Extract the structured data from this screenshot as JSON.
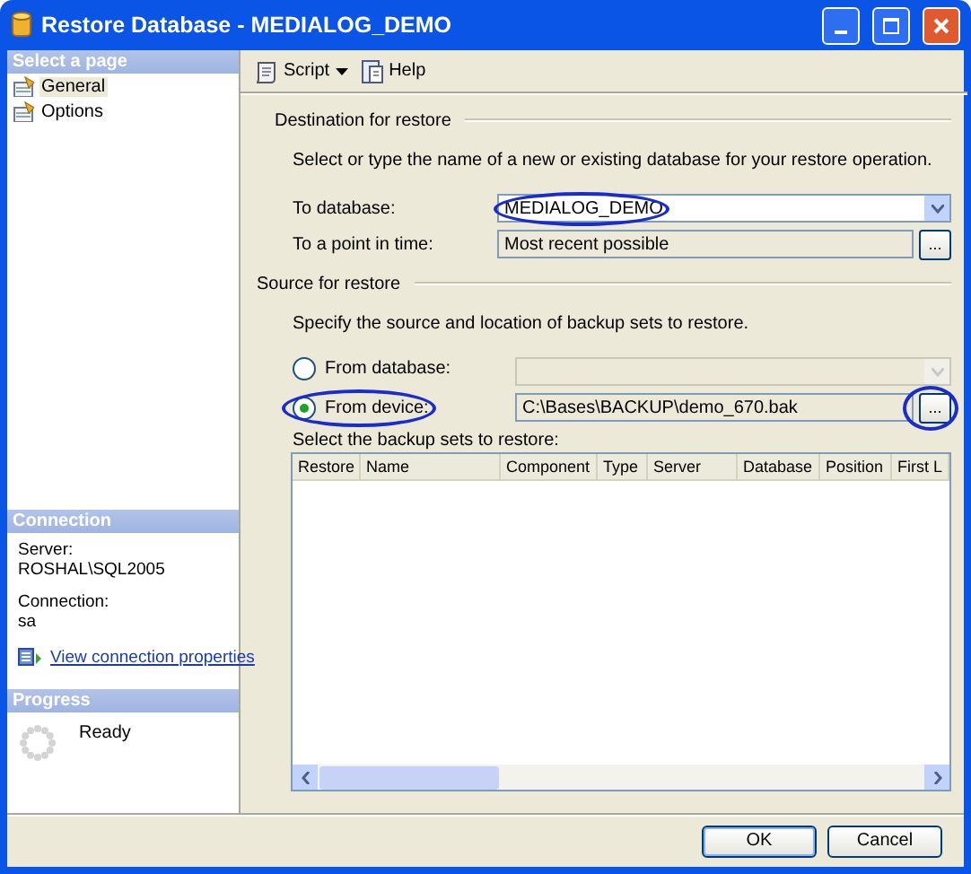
{
  "window": {
    "title": "Restore Database - MEDIALOG_DEMO"
  },
  "sidebar": {
    "header": "Select a page",
    "pages": [
      {
        "label": "General",
        "selected": true
      },
      {
        "label": "Options",
        "selected": false
      }
    ]
  },
  "connection": {
    "header": "Connection",
    "server_label": "Server:",
    "server": "ROSHAL\\SQL2005",
    "connection_label": "Connection:",
    "user": "sa",
    "link": "View connection properties"
  },
  "progress": {
    "header": "Progress",
    "status": "Ready"
  },
  "toolbar": {
    "script": "Script",
    "help": "Help"
  },
  "destination": {
    "title": "Destination for restore",
    "instruction": "Select or type the name of a new or existing database for your restore operation.",
    "to_database": {
      "label": "To database:",
      "value": "MEDIALOG_DEMO",
      "circled": true
    },
    "point_in_time": {
      "label": "To a point in time:",
      "value": "Most recent possible",
      "browse": "..."
    }
  },
  "source": {
    "title": "Source for restore",
    "instruction": "Specify the source and location of backup sets to restore.",
    "options": [
      {
        "label": "From database:",
        "selected": false,
        "enabled": false,
        "circled": false
      },
      {
        "label": "From device:",
        "selected": true,
        "value": "C:\\Bases\\BACKUP\\demo_670.bak",
        "enabled": true,
        "circled": true
      }
    ],
    "browse": {
      "label": "...",
      "circled": true
    },
    "table_label": "Select the backup sets to restore:",
    "table": {
      "columns": [
        "Restore",
        "Name",
        "Component",
        "Type",
        "Server",
        "Database",
        "Position",
        "First L"
      ]
    }
  },
  "buttons": [
    "OK",
    "Cancel"
  ]
}
